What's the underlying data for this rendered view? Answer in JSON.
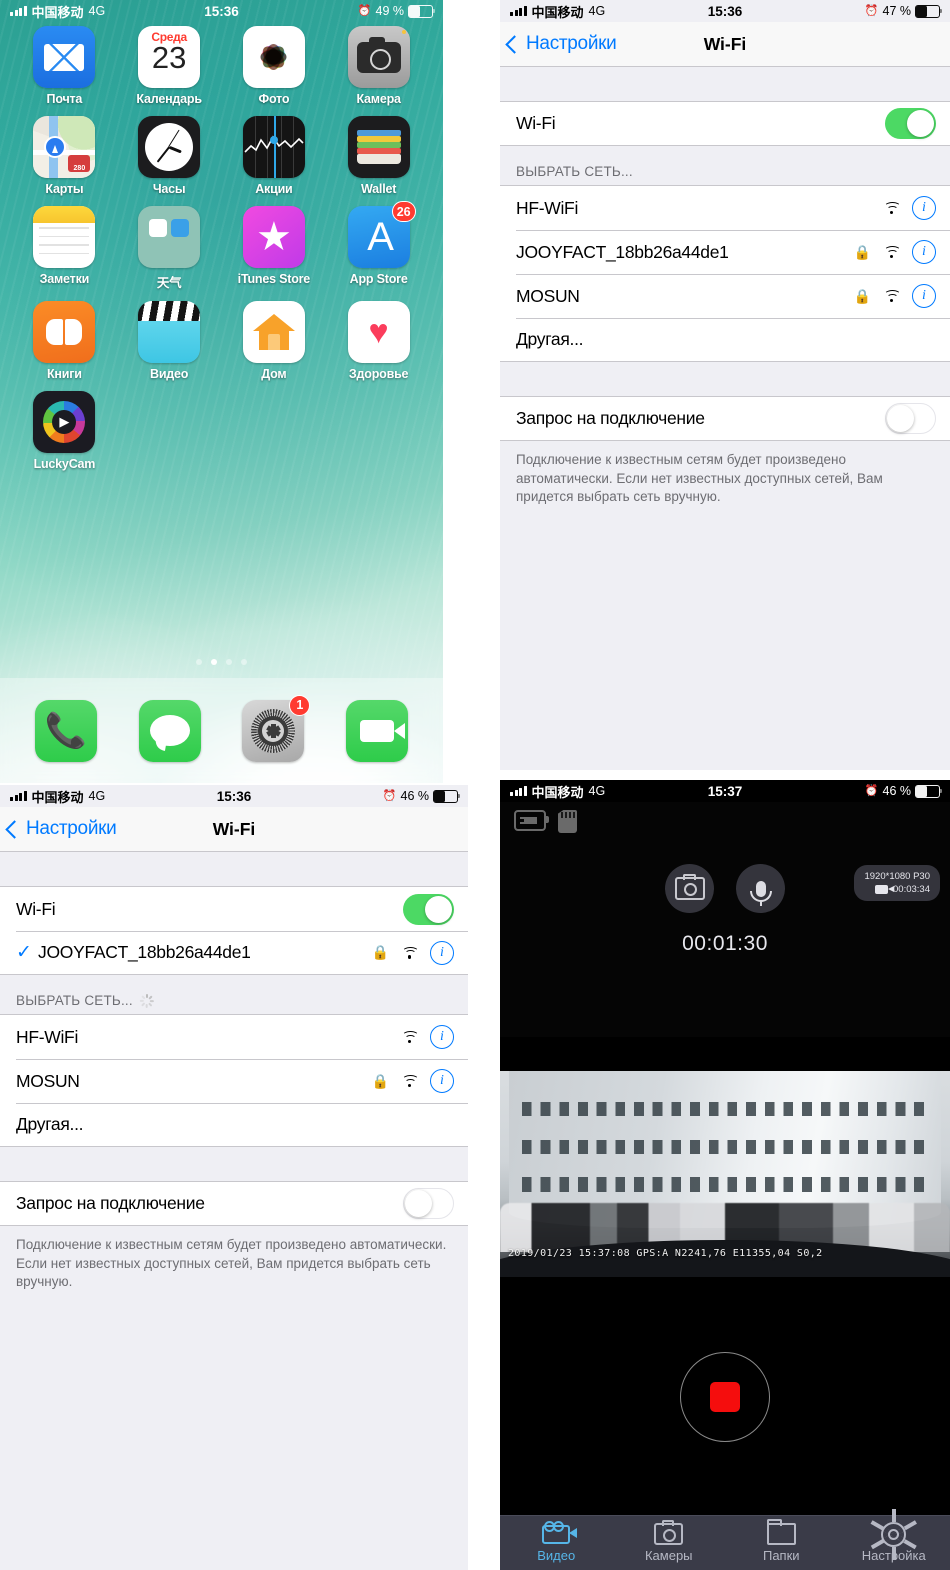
{
  "home": {
    "status": {
      "carrier": "中国移动",
      "network": "4G",
      "time": "15:36",
      "battery_pct": "49 %",
      "alarm_icon": "alarm-icon"
    },
    "apps": [
      {
        "label": "Почта",
        "icon": "mail-icon"
      },
      {
        "label": "Календарь",
        "icon": "calendar-icon",
        "weekday": "Среда",
        "day": "23"
      },
      {
        "label": "Фото",
        "icon": "photos-icon"
      },
      {
        "label": "Камера",
        "icon": "camera-icon"
      },
      {
        "label": "Карты",
        "icon": "maps-icon",
        "shield": "280"
      },
      {
        "label": "Часы",
        "icon": "clock-icon"
      },
      {
        "label": "Акции",
        "icon": "stocks-icon"
      },
      {
        "label": "Wallet",
        "icon": "wallet-icon"
      },
      {
        "label": "Заметки",
        "icon": "notes-icon"
      },
      {
        "label": "天气",
        "icon": "weather-folder-icon"
      },
      {
        "label": "iTunes Store",
        "icon": "itunes-store-icon"
      },
      {
        "label": "App Store",
        "icon": "app-store-icon",
        "badge": "26"
      },
      {
        "label": "Книги",
        "icon": "books-icon"
      },
      {
        "label": "Видео",
        "icon": "videos-icon"
      },
      {
        "label": "Дом",
        "icon": "home-app-icon"
      },
      {
        "label": "Здоровье",
        "icon": "health-icon"
      },
      {
        "label": "LuckyCam",
        "icon": "luckycam-icon"
      }
    ],
    "dock": [
      {
        "label": "Телефон",
        "icon": "phone-icon"
      },
      {
        "label": "Сообщения",
        "icon": "messages-icon"
      },
      {
        "label": "Настройки",
        "icon": "settings-gear-icon",
        "badge": "1"
      },
      {
        "label": "FaceTime",
        "icon": "facetime-icon"
      }
    ],
    "page_dots": 4,
    "active_dot": 2
  },
  "wifi_scan": {
    "status": {
      "carrier": "中国移动",
      "network": "4G",
      "time": "15:36",
      "battery_pct": "47 %"
    },
    "nav": {
      "back": "Настройки",
      "title": "Wi-Fi"
    },
    "toggle_label": "Wi-Fi",
    "toggle_state": "on",
    "section_header": "ВЫБРАТЬ СЕТЬ...",
    "networks": [
      {
        "ssid": "HF-WiFi",
        "secured": false,
        "connected": false
      },
      {
        "ssid": "JOOYFACT_18bb26a44de1",
        "secured": true,
        "connected": false
      },
      {
        "ssid": "MOSUN",
        "secured": true,
        "connected": false
      }
    ],
    "other_label": "Другая...",
    "ask_label": "Запрос на подключение",
    "ask_state": "off",
    "footer": "Подключение к известным сетям будет произведено автоматически. Если нет известных доступных сетей, Вам придется выбрать сеть вручную."
  },
  "wifi_connected": {
    "status": {
      "carrier": "中国移动",
      "network": "4G",
      "time": "15:36",
      "battery_pct": "46 %"
    },
    "nav": {
      "back": "Настройки",
      "title": "Wi-Fi"
    },
    "toggle_label": "Wi-Fi",
    "toggle_state": "on",
    "connected_ssid": "JOOYFACT_18bb26a44de1",
    "section_header": "ВЫБРАТЬ СЕТЬ...",
    "scanning": true,
    "networks": [
      {
        "ssid": "HF-WiFi",
        "secured": false
      },
      {
        "ssid": "MOSUN",
        "secured": true
      }
    ],
    "other_label": "Другая...",
    "ask_label": "Запрос на подключение",
    "ask_state": "off",
    "footer": "Подключение к известным сетям будет произведено автоматически. Если нет известных доступных сетей, Вам придется выбрать сеть вручную."
  },
  "dashcam": {
    "status": {
      "carrier": "中国移动",
      "network": "4G",
      "time": "15:37",
      "battery_pct": "46 %"
    },
    "device_icons": [
      "battery-charging-icon",
      "sd-card-icon"
    ],
    "controls": [
      {
        "name": "snapshot-button",
        "icon": "camera-shutter-icon"
      },
      {
        "name": "microphone-button",
        "icon": "microphone-icon"
      }
    ],
    "resolution": "1920*1080 P30",
    "clip_length": "00:03:34",
    "elapsed": "00:01:30",
    "gps_overlay": "2019/01/23 15:37:08 GPS:A N2241,76 E11355,04 S0,2",
    "record_button": "stop-record-button",
    "tabs": [
      {
        "label": "Видео",
        "icon": "video-camera-icon",
        "active": true
      },
      {
        "label": "Камеры",
        "icon": "photo-camera-icon",
        "active": false
      },
      {
        "label": "Папки",
        "icon": "folder-icon",
        "active": false
      },
      {
        "label": "Настройка",
        "icon": "gear-icon",
        "active": false
      }
    ]
  },
  "colors": {
    "ios_blue": "#007aff",
    "toggle_green": "#4cd964",
    "badge_red": "#ff3b30",
    "record_red": "#f50d0d",
    "tab_active": "#56b6e8"
  }
}
